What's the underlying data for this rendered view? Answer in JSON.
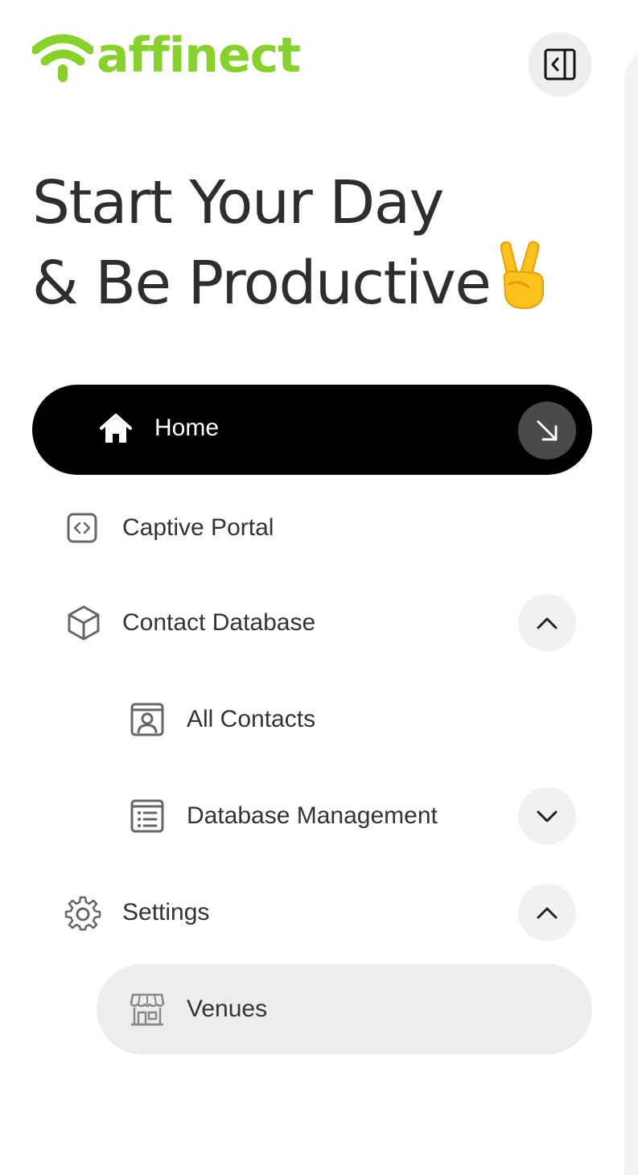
{
  "brand": {
    "name": "affinect",
    "color": "#86d12a"
  },
  "headline": {
    "line1": "Start Your Day",
    "line2": "& Be Productive",
    "emoji": "victory-hand"
  },
  "nav": {
    "home": {
      "label": "Home",
      "icon": "home-icon",
      "active": true
    },
    "captive_portal": {
      "label": "Captive Portal",
      "icon": "code-icon"
    },
    "contact_database": {
      "label": "Contact Database",
      "icon": "cube-icon",
      "expanded": true
    },
    "all_contacts": {
      "label": "All Contacts",
      "icon": "contact-card-icon"
    },
    "database_management": {
      "label": "Database Management",
      "icon": "list-icon",
      "expanded": false
    },
    "settings": {
      "label": "Settings",
      "icon": "gear-icon",
      "expanded": true
    },
    "venues": {
      "label": "Venues",
      "icon": "storefront-icon",
      "selected": true
    }
  }
}
